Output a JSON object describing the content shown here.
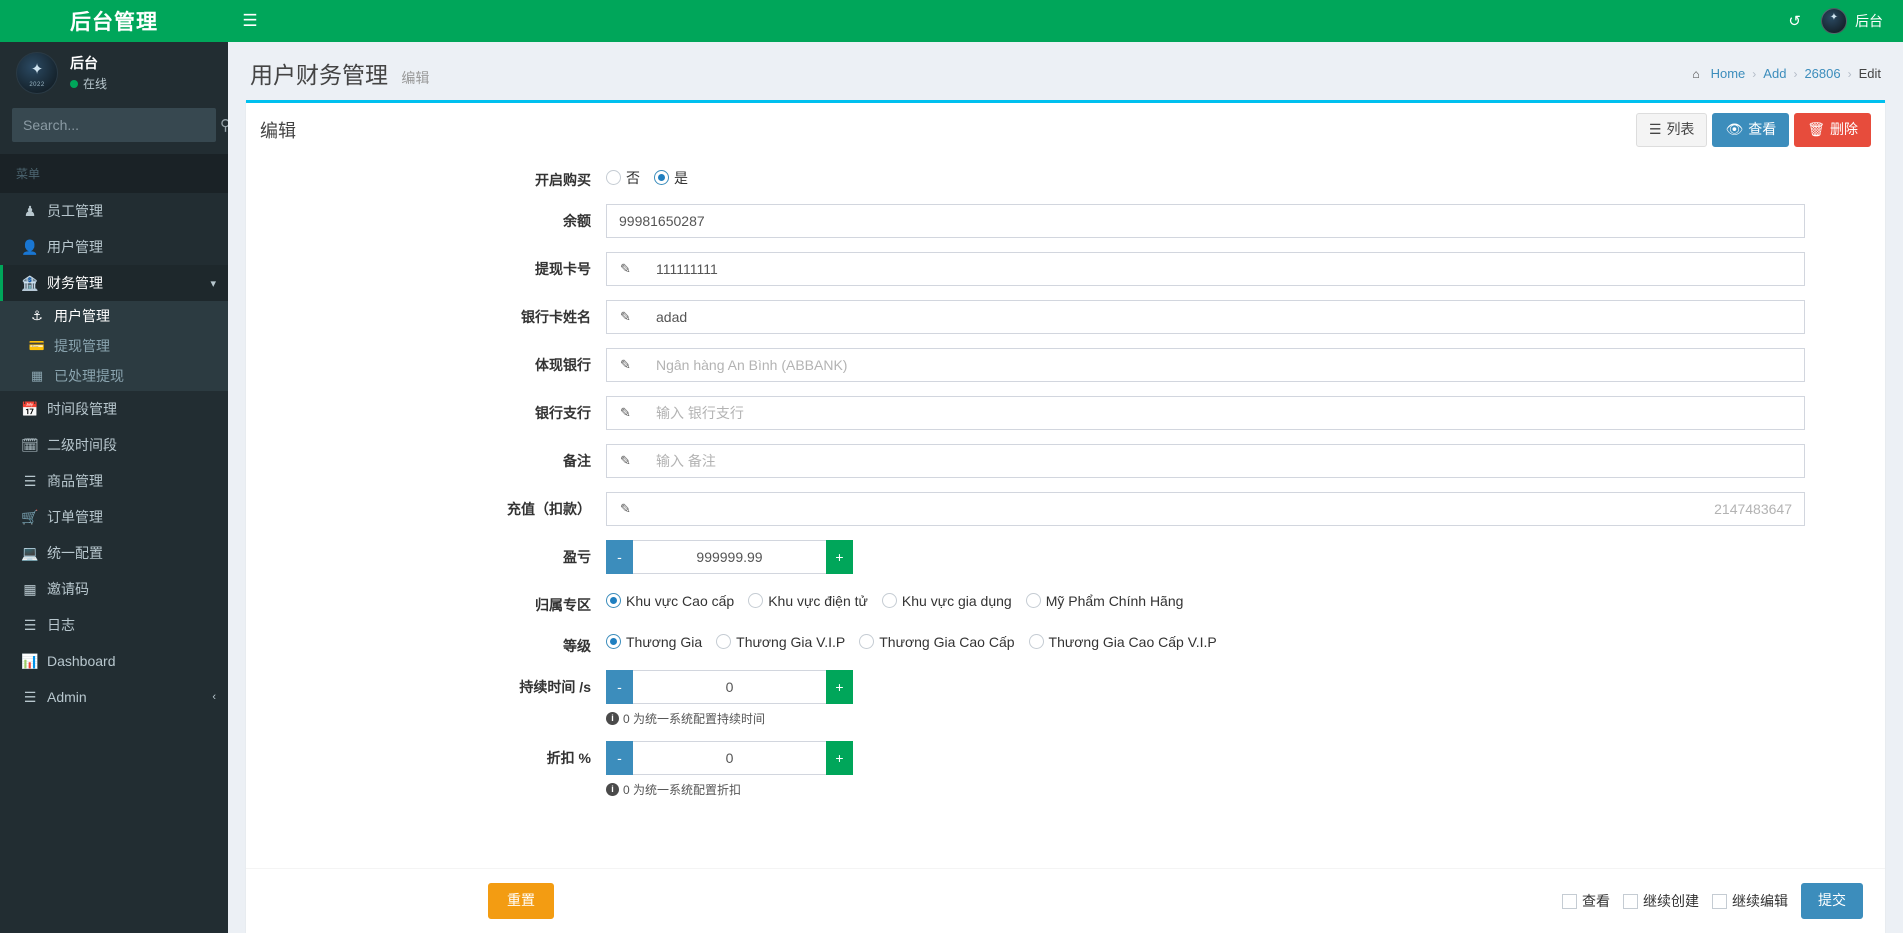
{
  "brand": {
    "title": "后台管理"
  },
  "sidebar": {
    "user": {
      "name": "后台",
      "status": "在线",
      "avatar_year": "2022"
    },
    "search": {
      "placeholder": "Search...",
      "value": "",
      "icon": "search-icon"
    },
    "menu_header": "菜单",
    "items": [
      {
        "label": "员工管理",
        "icon": "user-tie-icon",
        "active": false
      },
      {
        "label": "用户管理",
        "icon": "user-icon",
        "active": false
      },
      {
        "label": "财务管理",
        "icon": "bank-icon",
        "active": true,
        "caret": "chevron-down-icon",
        "children": [
          {
            "label": "用户管理",
            "icon": "anchor-icon",
            "active": true
          },
          {
            "label": "提现管理",
            "icon": "credit-card-icon",
            "active": false
          },
          {
            "label": "已处理提现",
            "icon": "building-icon",
            "active": false
          }
        ]
      },
      {
        "label": "时间段管理",
        "icon": "calendar-icon",
        "active": false
      },
      {
        "label": "二级时间段",
        "icon": "calendar-check-icon",
        "active": false
      },
      {
        "label": "商品管理",
        "icon": "database-icon",
        "active": false
      },
      {
        "label": "订单管理",
        "icon": "cart-icon",
        "active": false
      },
      {
        "label": "统一配置",
        "icon": "monitor-icon",
        "active": false
      },
      {
        "label": "邀请码",
        "icon": "barcode-icon",
        "active": false
      },
      {
        "label": "日志",
        "icon": "list-icon",
        "active": false
      },
      {
        "label": "Dashboard",
        "icon": "chart-bar-icon",
        "active": false
      },
      {
        "label": "Admin",
        "icon": "bars-icon",
        "active": false,
        "caret": "chevron-left-icon"
      }
    ]
  },
  "topbar": {
    "menu_toggle_icon": "hamburger-icon",
    "refresh_icon": "refresh-icon",
    "user_label": "后台"
  },
  "header": {
    "title": "用户财务管理",
    "subtitle": "编辑",
    "breadcrumb": [
      {
        "label": "Home",
        "icon": "home-icon",
        "link": true
      },
      {
        "label": "Add",
        "link": true
      },
      {
        "label": "26806",
        "link": true
      },
      {
        "label": "Edit",
        "link": false
      }
    ],
    "separator": "›"
  },
  "box": {
    "title": "编辑",
    "tools": [
      {
        "label": "列表",
        "icon": "list-icon",
        "style": "default"
      },
      {
        "label": "查看",
        "icon": "eye-icon",
        "style": "info"
      },
      {
        "label": "删除",
        "icon": "trash-icon",
        "style": "danger"
      }
    ]
  },
  "form": {
    "purchase": {
      "label": "开启购买",
      "options": [
        {
          "label": "否",
          "checked": false
        },
        {
          "label": "是",
          "checked": true
        }
      ]
    },
    "balance": {
      "label": "余额",
      "value": "99981650287",
      "placeholder": ""
    },
    "card_no": {
      "label": "提现卡号",
      "value": "111111111",
      "placeholder": "",
      "icon": "pencil-icon"
    },
    "card_name": {
      "label": "银行卡姓名",
      "value": "adad",
      "placeholder": "",
      "icon": "pencil-icon"
    },
    "bank": {
      "label": "体现银行",
      "value": "",
      "placeholder": "Ngân hàng An Bình (ABBANK)",
      "icon": "pencil-icon"
    },
    "branch": {
      "label": "银行支行",
      "value": "",
      "placeholder": "输入 银行支行",
      "icon": "pencil-icon"
    },
    "remark": {
      "label": "备注",
      "value": "",
      "placeholder": "输入 备注",
      "icon": "pencil-icon"
    },
    "recharge": {
      "label": "充值（扣款）",
      "value": "",
      "placeholder": "2147483647",
      "icon": "pencil-icon"
    },
    "profit": {
      "label": "盈亏",
      "value": "999999.99",
      "minus_label": "-",
      "plus_label": "+"
    },
    "zone": {
      "label": "归属专区",
      "options": [
        {
          "label": "Khu vực Cao cấp",
          "checked": true
        },
        {
          "label": "Khu vực điện tử",
          "checked": false
        },
        {
          "label": "Khu vực gia dụng",
          "checked": false
        },
        {
          "label": "Mỹ Phẩm Chính Hãng",
          "checked": false
        }
      ]
    },
    "level": {
      "label": "等级",
      "options": [
        {
          "label": "Thương Gia",
          "checked": true
        },
        {
          "label": "Thương Gia V.I.P",
          "checked": false
        },
        {
          "label": "Thương Gia Cao Cấp",
          "checked": false
        },
        {
          "label": "Thương Gia Cao Cấp V.I.P",
          "checked": false
        }
      ]
    },
    "duration": {
      "label": "持续时间 /s",
      "value": "0",
      "minus_label": "-",
      "plus_label": "+",
      "help": "0 为统一系统配置持续时间"
    },
    "discount": {
      "label": "折扣 %",
      "value": "0",
      "minus_label": "-",
      "plus_label": "+",
      "help": "0 为统一系统配置折扣"
    }
  },
  "footer": {
    "reset_label": "重置",
    "checkboxes": [
      {
        "label": "查看",
        "checked": false
      },
      {
        "label": "继续创建",
        "checked": false
      },
      {
        "label": "继续编辑",
        "checked": false
      }
    ],
    "submit_label": "提交"
  },
  "colors": {
    "brand_green": "#00a65a",
    "accent_blue": "#3c8dbc",
    "box_top": "#00c0ef",
    "danger": "#e74c3c",
    "warning": "#f39c12",
    "sidebar": "#222d32",
    "body_bg": "#ecf0f5"
  }
}
